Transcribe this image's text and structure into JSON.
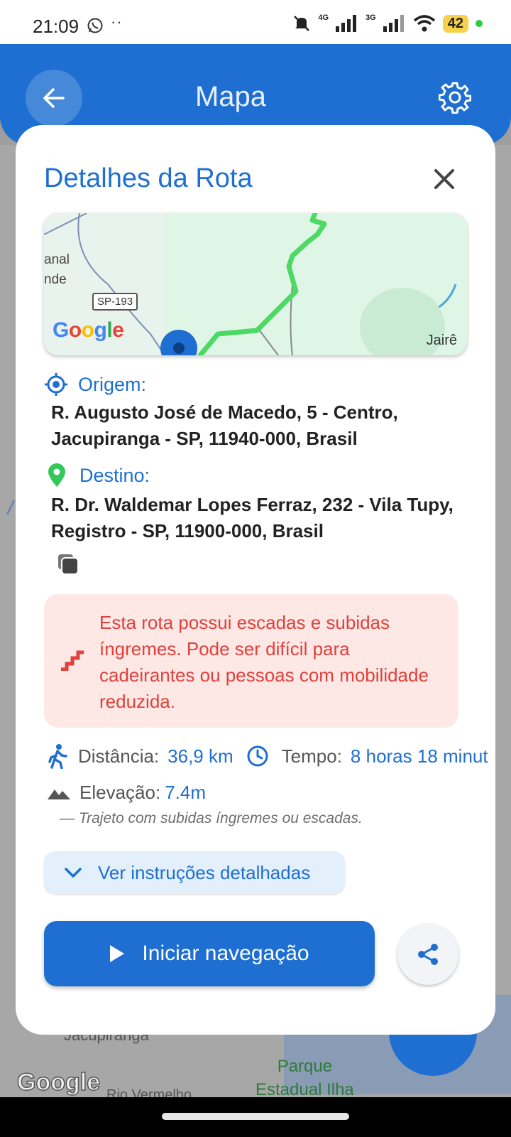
{
  "status_bar": {
    "time": "21:09",
    "dots": "··",
    "net1": "4G",
    "net2": "3G",
    "battery": "42"
  },
  "app_bar": {
    "title": "Mapa"
  },
  "background_map": {
    "label_jacupiranga": "Jacupiranga",
    "label_park_line1": "Parque",
    "label_park_line2": "Estadual Ilha",
    "label_rio": "Rio Vermelho",
    "google_logo": "Google"
  },
  "route_dialog": {
    "title": "Detalhes da Rota",
    "map_preview": {
      "label_line1": "anal",
      "label_line2": "nde",
      "road_shield": "SP-193",
      "google_logo": "Google",
      "place_label": "Jairê"
    },
    "origin": {
      "label": "Origem:",
      "address": "R. Augusto José de Macedo, 5 - Centro, Jacupiranga - SP, 11940-000, Brasil"
    },
    "destination": {
      "label": "Destino:",
      "address": "R. Dr. Waldemar Lopes Ferraz, 232 - Vila Tupy, Registro - SP, 11900-000, Brasil"
    },
    "warning": {
      "text": "Esta rota possui escadas e subidas íngremes. Pode ser difícil para cadeirantes ou pessoas com mobilidade reduzida.",
      "color": "#e0413b"
    },
    "stats": {
      "distance_label": "Distância:",
      "distance_value": "36,9 km",
      "time_label": "Tempo:",
      "time_value": "8 horas 18 minut",
      "elevation_label": "Elevação:",
      "elevation_value": "7.4m",
      "elevation_note": "— Trajeto com subidas íngremes ou escadas."
    },
    "instructions_button": "Ver instruções detalhadas",
    "start_button": "Iniciar navegação"
  },
  "colors": {
    "primary": "#1e6fd1",
    "route_green": "#4cd964",
    "warning_bg": "#fde8e6"
  }
}
